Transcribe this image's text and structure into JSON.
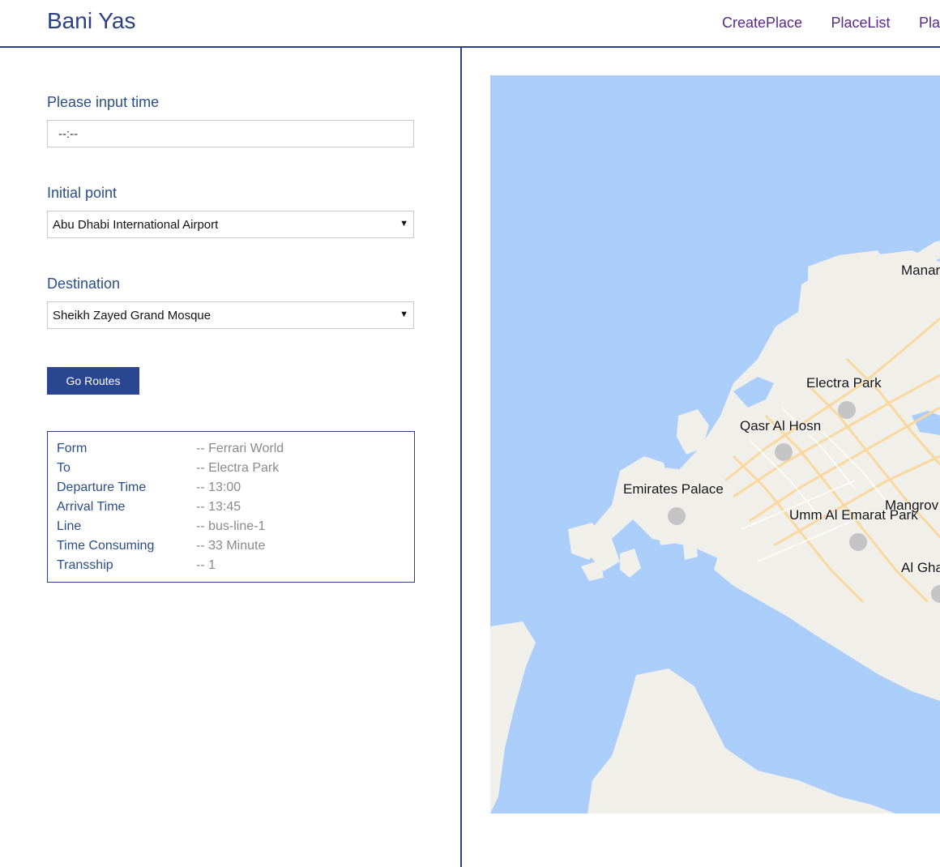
{
  "header": {
    "brand": "Bani Yas",
    "nav": [
      "CreatePlace",
      "PlaceList",
      "Pla"
    ]
  },
  "form": {
    "time_label": "Please input time",
    "time_value": "--:--",
    "initial_label": "Initial point",
    "initial_value": "Abu Dhabi International Airport",
    "destination_label": "Destination",
    "destination_value": "Sheikh Zayed Grand Mosque",
    "go_button": "Go Routes"
  },
  "result": {
    "rows": [
      {
        "key": "Form",
        "value": "-- Ferrari World"
      },
      {
        "key": "To",
        "value": "-- Electra Park"
      },
      {
        "key": "Departure Time",
        "value": "-- 13:00"
      },
      {
        "key": "Arrival Time",
        "value": "-- 13:45"
      },
      {
        "key": "Line",
        "value": "-- bus-line-1"
      },
      {
        "key": "Time Consuming",
        "value": "-- 33 Minute"
      },
      {
        "key": "Transship",
        "value": "-- 1"
      }
    ]
  },
  "map": {
    "water_color": "#aacdfa",
    "land_color": "#f0efea",
    "road_color": "#fad89d",
    "places": [
      "Manar",
      "Electra Park",
      "Qasr Al Hosn",
      "Emirates Palace",
      "Umm Al Emarat Park",
      "Mangrov",
      "Al Gha"
    ]
  }
}
